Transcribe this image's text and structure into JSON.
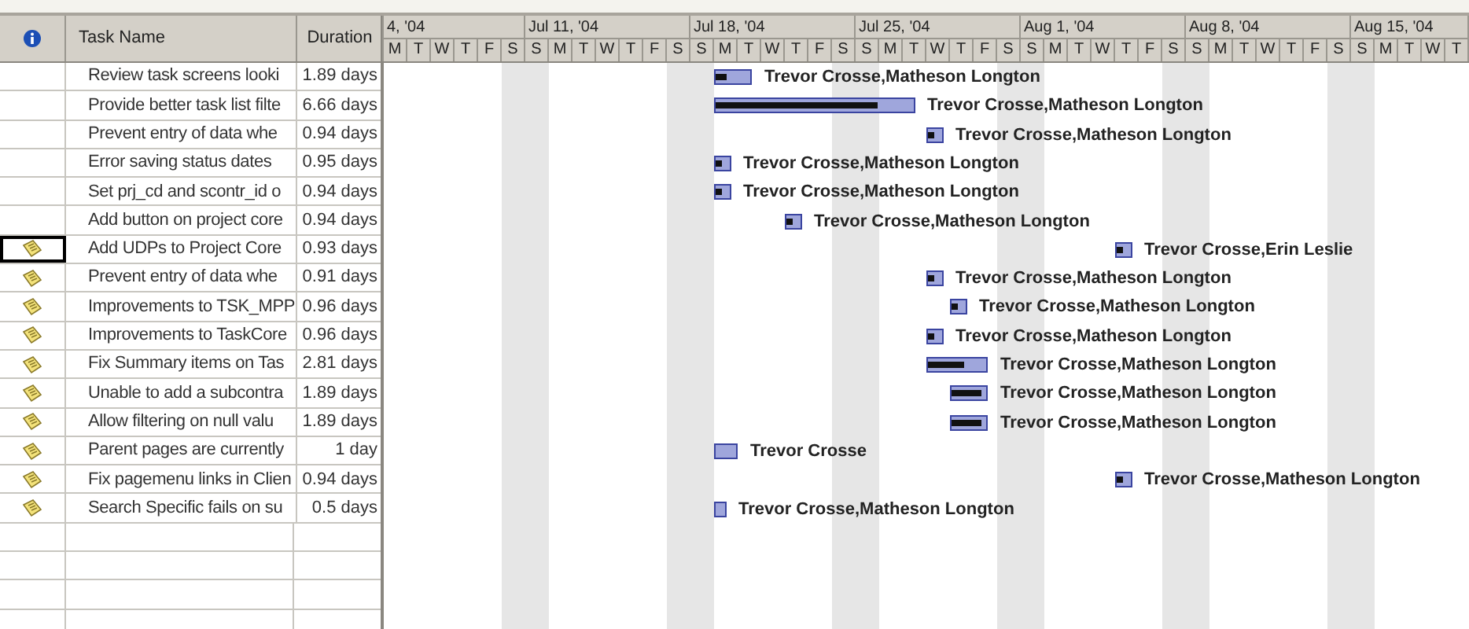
{
  "table": {
    "columns": [
      {
        "kind": "indicator"
      },
      {
        "kind": "text",
        "label": "Task Name"
      },
      {
        "kind": "text",
        "label": "Duration"
      }
    ],
    "rows": [
      {
        "note": false,
        "selected": false,
        "name": "Review task screens looki",
        "duration": "1.89 days",
        "bar": {
          "level": 0.3,
          "resources": "Trevor Crosse,Matheson Longton"
        }
      },
      {
        "note": false,
        "selected": false,
        "name": "Provide better task list filte",
        "duration": "6.66 days",
        "bar": {
          "level": 0.82,
          "resources": "Trevor Crosse,Matheson Longton"
        }
      },
      {
        "note": false,
        "selected": false,
        "name": "Prevent entry of data whe",
        "duration": "0.94 days",
        "bar": {
          "level": 0.5,
          "resources": "Trevor Crosse,Matheson Longton"
        }
      },
      {
        "note": false,
        "selected": false,
        "name": "Error saving status dates",
        "duration": "0.95 days",
        "bar": {
          "level": 0.5,
          "resources": "Trevor Crosse,Matheson Longton"
        }
      },
      {
        "note": false,
        "selected": false,
        "name": "Set prj_cd and scontr_id o",
        "duration": "0.94 days",
        "bar": {
          "level": 0.5,
          "resources": "Trevor Crosse,Matheson Longton"
        }
      },
      {
        "note": false,
        "selected": false,
        "name": "Add button on project core",
        "duration": "0.94 days",
        "bar": {
          "level": 0.5,
          "resources": "Trevor Crosse,Matheson Longton"
        }
      },
      {
        "note": true,
        "selected": true,
        "name": "Add UDPs to Project Core",
        "duration": "0.93 days",
        "bar": {
          "level": 0.5,
          "resources": "Trevor Crosse,Erin Leslie"
        }
      },
      {
        "note": true,
        "selected": false,
        "name": "Prevent entry of data whe",
        "duration": "0.91 days",
        "bar": {
          "level": 0.5,
          "resources": "Trevor Crosse,Matheson Longton"
        }
      },
      {
        "note": true,
        "selected": false,
        "name": "Improvements to TSK_MPP",
        "duration": "0.96 days",
        "bar": {
          "level": 0.5,
          "resources": "Trevor Crosse,Matheson Longton"
        }
      },
      {
        "note": true,
        "selected": false,
        "name": "Improvements to TaskCore",
        "duration": "0.96 days",
        "bar": {
          "level": 0.5,
          "resources": "Trevor Crosse,Matheson Longton"
        }
      },
      {
        "note": true,
        "selected": false,
        "name": "Fix Summary items on Tas",
        "duration": "2.81 days",
        "bar": {
          "level": 0.62,
          "resources": "Trevor Crosse,Matheson Longton"
        }
      },
      {
        "note": true,
        "selected": false,
        "name": "Unable to add a subcontra",
        "duration": "1.89 days",
        "bar": {
          "level": 0.85,
          "resources": "Trevor Crosse,Matheson Longton"
        }
      },
      {
        "note": true,
        "selected": false,
        "name": "Allow filtering on null valu",
        "duration": "1.89 days",
        "bar": {
          "level": 0.85,
          "resources": "Trevor Crosse,Matheson Longton"
        }
      },
      {
        "note": true,
        "selected": false,
        "name": "Parent pages are currently",
        "duration": "1 day",
        "bar": {
          "resources": "Trevor Crosse"
        }
      },
      {
        "note": true,
        "selected": false,
        "name": "Fix pagemenu links in Clien",
        "duration": "0.94 days",
        "bar": {
          "level": 0.5,
          "resources": "Trevor Crosse,Matheson Longton"
        }
      },
      {
        "note": true,
        "selected": false,
        "name": "Search Specific fails on su",
        "duration": "0.5 days",
        "bar": {
          "resources": "Trevor Crosse,Matheson Longton"
        }
      }
    ]
  },
  "timescale": {
    "weeks": [
      {
        "label": "4, '04",
        "days": [
          {
            "label": "M",
            "weekend": false
          },
          {
            "label": "T",
            "weekend": false
          },
          {
            "label": "W",
            "weekend": false
          },
          {
            "label": "T",
            "weekend": false
          },
          {
            "label": "F",
            "weekend": false
          },
          {
            "label": "S",
            "weekend": true
          }
        ]
      },
      {
        "label": "Jul 11, '04",
        "days": [
          {
            "label": "S",
            "weekend": true
          },
          {
            "label": "M",
            "weekend": false
          },
          {
            "label": "T",
            "weekend": false
          },
          {
            "label": "W",
            "weekend": false
          },
          {
            "label": "T",
            "weekend": false
          },
          {
            "label": "F",
            "weekend": false
          },
          {
            "label": "S",
            "weekend": true
          }
        ]
      },
      {
        "label": "Jul 18, '04",
        "days": [
          {
            "label": "S",
            "weekend": true
          },
          {
            "label": "M",
            "weekend": false
          },
          {
            "label": "T",
            "weekend": false
          },
          {
            "label": "W",
            "weekend": false
          },
          {
            "label": "T",
            "weekend": false
          },
          {
            "label": "F",
            "weekend": false
          },
          {
            "label": "S",
            "weekend": true
          }
        ]
      },
      {
        "label": "Jul 25, '04",
        "days": [
          {
            "label": "S",
            "weekend": true
          },
          {
            "label": "M",
            "weekend": false
          },
          {
            "label": "T",
            "weekend": false
          },
          {
            "label": "W",
            "weekend": false
          },
          {
            "label": "T",
            "weekend": false
          },
          {
            "label": "F",
            "weekend": false
          },
          {
            "label": "S",
            "weekend": true
          }
        ]
      },
      {
        "label": "Aug 1, '04",
        "days": [
          {
            "label": "S",
            "weekend": true
          },
          {
            "label": "M",
            "weekend": false
          },
          {
            "label": "T",
            "weekend": false
          },
          {
            "label": "W",
            "weekend": false
          },
          {
            "label": "T",
            "weekend": false
          },
          {
            "label": "F",
            "weekend": false
          },
          {
            "label": "S",
            "weekend": true
          }
        ]
      },
      {
        "label": "Aug 8, '04",
        "days": [
          {
            "label": "S",
            "weekend": true
          },
          {
            "label": "M",
            "weekend": false
          },
          {
            "label": "T",
            "weekend": false
          },
          {
            "label": "W",
            "weekend": false
          },
          {
            "label": "T",
            "weekend": false
          },
          {
            "label": "F",
            "weekend": false
          },
          {
            "label": "S",
            "weekend": true
          }
        ]
      },
      {
        "label": "Aug 15, '04",
        "days": [
          {
            "label": "S",
            "weekend": true
          },
          {
            "label": "M",
            "weekend": false
          },
          {
            "label": "T",
            "weekend": false
          },
          {
            "label": "W",
            "weekend": false
          },
          {
            "label": "T",
            "weekend": false
          }
        ]
      }
    ]
  }
}
